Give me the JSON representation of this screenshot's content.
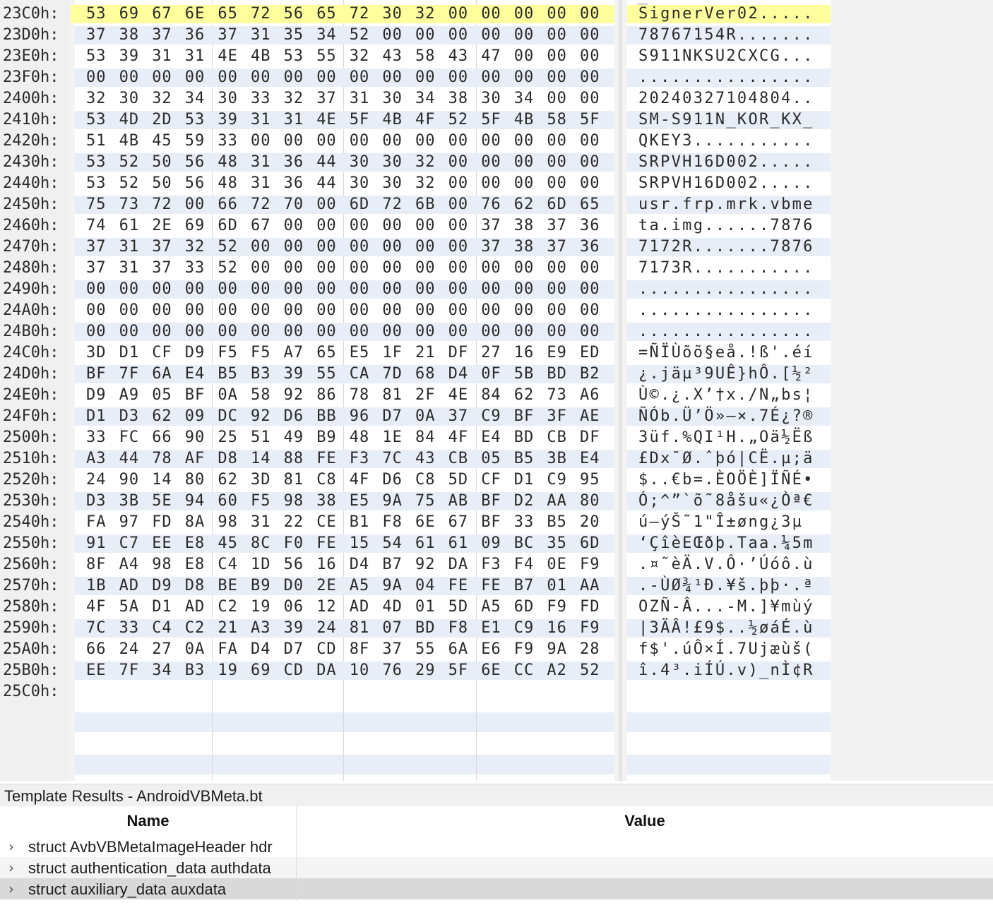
{
  "hex_rows": [
    {
      "addr": "23C0h:",
      "bytes": [
        "53",
        "69",
        "67",
        "6E",
        "65",
        "72",
        "56",
        "65",
        "72",
        "30",
        "32",
        "00",
        "00",
        "00",
        "00",
        "00"
      ],
      "ascii": "SignerVer02.....",
      "selected": true
    },
    {
      "addr": "23D0h:",
      "bytes": [
        "37",
        "38",
        "37",
        "36",
        "37",
        "31",
        "35",
        "34",
        "52",
        "00",
        "00",
        "00",
        "00",
        "00",
        "00",
        "00"
      ],
      "ascii": "78767154R......."
    },
    {
      "addr": "23E0h:",
      "bytes": [
        "53",
        "39",
        "31",
        "31",
        "4E",
        "4B",
        "53",
        "55",
        "32",
        "43",
        "58",
        "43",
        "47",
        "00",
        "00",
        "00"
      ],
      "ascii": "S911NKSU2CXCG..."
    },
    {
      "addr": "23F0h:",
      "bytes": [
        "00",
        "00",
        "00",
        "00",
        "00",
        "00",
        "00",
        "00",
        "00",
        "00",
        "00",
        "00",
        "00",
        "00",
        "00",
        "00"
      ],
      "ascii": "................"
    },
    {
      "addr": "2400h:",
      "bytes": [
        "32",
        "30",
        "32",
        "34",
        "30",
        "33",
        "32",
        "37",
        "31",
        "30",
        "34",
        "38",
        "30",
        "34",
        "00",
        "00"
      ],
      "ascii": "20240327104804.."
    },
    {
      "addr": "2410h:",
      "bytes": [
        "53",
        "4D",
        "2D",
        "53",
        "39",
        "31",
        "31",
        "4E",
        "5F",
        "4B",
        "4F",
        "52",
        "5F",
        "4B",
        "58",
        "5F"
      ],
      "ascii": "SM-S911N_KOR_KX_"
    },
    {
      "addr": "2420h:",
      "bytes": [
        "51",
        "4B",
        "45",
        "59",
        "33",
        "00",
        "00",
        "00",
        "00",
        "00",
        "00",
        "00",
        "00",
        "00",
        "00",
        "00"
      ],
      "ascii": "QKEY3..........."
    },
    {
      "addr": "2430h:",
      "bytes": [
        "53",
        "52",
        "50",
        "56",
        "48",
        "31",
        "36",
        "44",
        "30",
        "30",
        "32",
        "00",
        "00",
        "00",
        "00",
        "00"
      ],
      "ascii": "SRPVH16D002....."
    },
    {
      "addr": "2440h:",
      "bytes": [
        "53",
        "52",
        "50",
        "56",
        "48",
        "31",
        "36",
        "44",
        "30",
        "30",
        "32",
        "00",
        "00",
        "00",
        "00",
        "00"
      ],
      "ascii": "SRPVH16D002....."
    },
    {
      "addr": "2450h:",
      "bytes": [
        "75",
        "73",
        "72",
        "00",
        "66",
        "72",
        "70",
        "00",
        "6D",
        "72",
        "6B",
        "00",
        "76",
        "62",
        "6D",
        "65"
      ],
      "ascii": "usr.frp.mrk.vbme"
    },
    {
      "addr": "2460h:",
      "bytes": [
        "74",
        "61",
        "2E",
        "69",
        "6D",
        "67",
        "00",
        "00",
        "00",
        "00",
        "00",
        "00",
        "37",
        "38",
        "37",
        "36"
      ],
      "ascii": "ta.img......7876"
    },
    {
      "addr": "2470h:",
      "bytes": [
        "37",
        "31",
        "37",
        "32",
        "52",
        "00",
        "00",
        "00",
        "00",
        "00",
        "00",
        "00",
        "37",
        "38",
        "37",
        "36"
      ],
      "ascii": "7172R.......7876"
    },
    {
      "addr": "2480h:",
      "bytes": [
        "37",
        "31",
        "37",
        "33",
        "52",
        "00",
        "00",
        "00",
        "00",
        "00",
        "00",
        "00",
        "00",
        "00",
        "00",
        "00"
      ],
      "ascii": "7173R..........."
    },
    {
      "addr": "2490h:",
      "bytes": [
        "00",
        "00",
        "00",
        "00",
        "00",
        "00",
        "00",
        "00",
        "00",
        "00",
        "00",
        "00",
        "00",
        "00",
        "00",
        "00"
      ],
      "ascii": "................"
    },
    {
      "addr": "24A0h:",
      "bytes": [
        "00",
        "00",
        "00",
        "00",
        "00",
        "00",
        "00",
        "00",
        "00",
        "00",
        "00",
        "00",
        "00",
        "00",
        "00",
        "00"
      ],
      "ascii": "................"
    },
    {
      "addr": "24B0h:",
      "bytes": [
        "00",
        "00",
        "00",
        "00",
        "00",
        "00",
        "00",
        "00",
        "00",
        "00",
        "00",
        "00",
        "00",
        "00",
        "00",
        "00"
      ],
      "ascii": "................"
    },
    {
      "addr": "24C0h:",
      "bytes": [
        "3D",
        "D1",
        "CF",
        "D9",
        "F5",
        "F5",
        "A7",
        "65",
        "E5",
        "1F",
        "21",
        "DF",
        "27",
        "16",
        "E9",
        "ED"
      ],
      "ascii": "=ÑÏÙõõ§eå.!ß'.éí"
    },
    {
      "addr": "24D0h:",
      "bytes": [
        "BF",
        "7F",
        "6A",
        "E4",
        "B5",
        "B3",
        "39",
        "55",
        "CA",
        "7D",
        "68",
        "D4",
        "0F",
        "5B",
        "BD",
        "B2"
      ],
      "ascii": "¿.jäµ³9UÊ}hÔ.[½²"
    },
    {
      "addr": "24E0h:",
      "bytes": [
        "D9",
        "A9",
        "05",
        "BF",
        "0A",
        "58",
        "92",
        "86",
        "78",
        "81",
        "2F",
        "4E",
        "84",
        "62",
        "73",
        "A6"
      ],
      "ascii": "Ù©.¿.X’†x./N„bs¦"
    },
    {
      "addr": "24F0h:",
      "bytes": [
        "D1",
        "D3",
        "62",
        "09",
        "DC",
        "92",
        "D6",
        "BB",
        "96",
        "D7",
        "0A",
        "37",
        "C9",
        "BF",
        "3F",
        "AE"
      ],
      "ascii": "ÑÓb.Ü’Ö»–×.7É¿?®"
    },
    {
      "addr": "2500h:",
      "bytes": [
        "33",
        "FC",
        "66",
        "90",
        "25",
        "51",
        "49",
        "B9",
        "48",
        "1E",
        "84",
        "4F",
        "E4",
        "BD",
        "CB",
        "DF"
      ],
      "ascii": "3üf.%QI¹H.„Oä½Ëß"
    },
    {
      "addr": "2510h:",
      "bytes": [
        "A3",
        "44",
        "78",
        "AF",
        "D8",
        "14",
        "88",
        "FE",
        "F3",
        "7C",
        "43",
        "CB",
        "05",
        "B5",
        "3B",
        "E4"
      ],
      "ascii": "£Dx¯Ø.ˆþó|CË.µ;ä"
    },
    {
      "addr": "2520h:",
      "bytes": [
        "24",
        "90",
        "14",
        "80",
        "62",
        "3D",
        "81",
        "C8",
        "4F",
        "D6",
        "C8",
        "5D",
        "CF",
        "D1",
        "C9",
        "95"
      ],
      "ascii": "$..€b=.ÈOÖÈ]ÏÑÉ•"
    },
    {
      "addr": "2530h:",
      "bytes": [
        "D3",
        "3B",
        "5E",
        "94",
        "60",
        "F5",
        "98",
        "38",
        "E5",
        "9A",
        "75",
        "AB",
        "BF",
        "D2",
        "AA",
        "80"
      ],
      "ascii": "Ó;^”`õ˜8åšu«¿Òª€"
    },
    {
      "addr": "2540h:",
      "bytes": [
        "FA",
        "97",
        "FD",
        "8A",
        "98",
        "31",
        "22",
        "CE",
        "B1",
        "F8",
        "6E",
        "67",
        "BF",
        "33",
        "B5",
        "20"
      ],
      "ascii": "ú—ýŠ˜1\"Î±øng¿3µ "
    },
    {
      "addr": "2550h:",
      "bytes": [
        "91",
        "C7",
        "EE",
        "E8",
        "45",
        "8C",
        "F0",
        "FE",
        "15",
        "54",
        "61",
        "61",
        "09",
        "BC",
        "35",
        "6D"
      ],
      "ascii": "‘ÇîèEŒðþ.Taa.¼5m"
    },
    {
      "addr": "2560h:",
      "bytes": [
        "8F",
        "A4",
        "98",
        "E8",
        "C4",
        "1D",
        "56",
        "16",
        "D4",
        "B7",
        "92",
        "DA",
        "F3",
        "F4",
        "0E",
        "F9"
      ],
      "ascii": ".¤˜èÄ.V.Ô·’Úóô.ù"
    },
    {
      "addr": "2570h:",
      "bytes": [
        "1B",
        "AD",
        "D9",
        "D8",
        "BE",
        "B9",
        "D0",
        "2E",
        "A5",
        "9A",
        "04",
        "FE",
        "FE",
        "B7",
        "01",
        "AA"
      ],
      "ascii": ".-ÙØ¾¹Ð.¥š.þþ·.ª"
    },
    {
      "addr": "2580h:",
      "bytes": [
        "4F",
        "5A",
        "D1",
        "AD",
        "C2",
        "19",
        "06",
        "12",
        "AD",
        "4D",
        "01",
        "5D",
        "A5",
        "6D",
        "F9",
        "FD"
      ],
      "ascii": "OZÑ-Â...-M.]¥mùý"
    },
    {
      "addr": "2590h:",
      "bytes": [
        "7C",
        "33",
        "C4",
        "C2",
        "21",
        "A3",
        "39",
        "24",
        "81",
        "07",
        "BD",
        "F8",
        "E1",
        "C9",
        "16",
        "F9"
      ],
      "ascii": "|3ÄÂ!£9$..½øáÉ.ù"
    },
    {
      "addr": "25A0h:",
      "bytes": [
        "66",
        "24",
        "27",
        "0A",
        "FA",
        "D4",
        "D7",
        "CD",
        "8F",
        "37",
        "55",
        "6A",
        "E6",
        "F9",
        "9A",
        "28"
      ],
      "ascii": "f$'.úÔ×Í.7Ujæùš("
    },
    {
      "addr": "25B0h:",
      "bytes": [
        "EE",
        "7F",
        "34",
        "B3",
        "19",
        "69",
        "CD",
        "DA",
        "10",
        "76",
        "29",
        "5F",
        "6E",
        "CC",
        "A2",
        "52"
      ],
      "ascii": "î.4³.iÍÚ.v)_nÌ¢R"
    },
    {
      "addr": "25C0h:",
      "bytes": [],
      "ascii": ""
    }
  ],
  "template": {
    "title": "Template Results - AndroidVBMeta.bt",
    "col_name": "Name",
    "col_value": "Value",
    "rows": [
      {
        "name": "struct AvbVBMetaImageHeader hdr",
        "value": "",
        "icon": "chevron-right-icon"
      },
      {
        "name": "struct authentication_data authdata",
        "value": "",
        "icon": "chevron-right-icon"
      },
      {
        "name": "struct auxiliary_data auxdata",
        "value": "",
        "icon": "chevron-right-icon",
        "selected": true
      }
    ]
  },
  "colors": {
    "selection": "#ffff9e",
    "stripe": "#e8eef8",
    "selected_row": "#d9d9d9"
  }
}
